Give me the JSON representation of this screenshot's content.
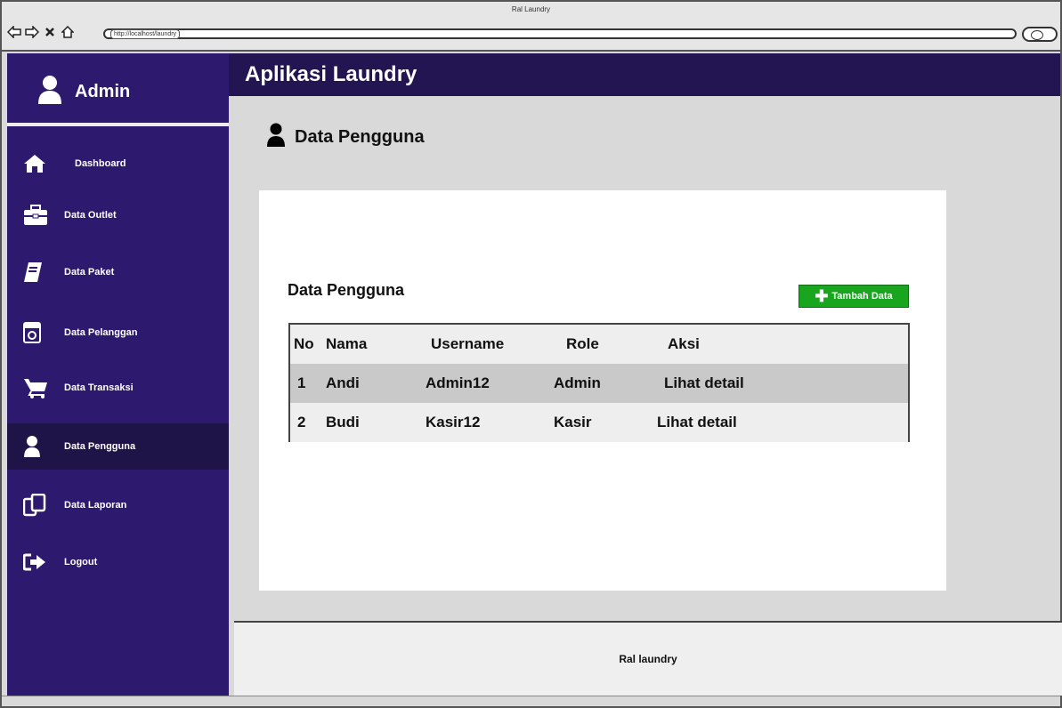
{
  "browser": {
    "window_title": "Ral Laundry",
    "address": "http://localhost/laundry"
  },
  "sidebar": {
    "user": "Admin",
    "items": [
      {
        "label": "Dashboard",
        "icon": "home-icon",
        "active": false
      },
      {
        "label": "Data Outlet",
        "icon": "briefcase-icon",
        "active": false
      },
      {
        "label": "Data Paket",
        "icon": "book-icon",
        "active": false
      },
      {
        "label": "Data Pelanggan",
        "icon": "box-icon",
        "active": false
      },
      {
        "label": "Data Transaksi",
        "icon": "cart-icon",
        "active": false
      },
      {
        "label": "Data Pengguna",
        "icon": "user-icon",
        "active": true
      },
      {
        "label": "Data Laporan",
        "icon": "copy-icon",
        "active": false
      },
      {
        "label": "Logout",
        "icon": "logout-icon",
        "active": false
      }
    ]
  },
  "header": {
    "title": "Aplikasi Laundry"
  },
  "page": {
    "heading": "Data Pengguna",
    "card_title": "Data Pengguna",
    "add_button": "Tambah Data"
  },
  "table": {
    "columns": [
      "No",
      "Nama",
      "Username",
      "Role",
      "Aksi"
    ],
    "rows": [
      [
        "1",
        "Andi",
        "Admin12",
        "Admin",
        "Lihat detail"
      ],
      [
        "2",
        "Budi",
        "Kasir12",
        "Kasir",
        "Lihat detail"
      ]
    ]
  },
  "footer": {
    "text": "Ral laundry"
  },
  "colors": {
    "sidebar_bg": "#2d1a6e",
    "topbar_bg": "#231552",
    "active_item_bg": "#1f1448",
    "add_button_bg": "#1aa51f"
  }
}
